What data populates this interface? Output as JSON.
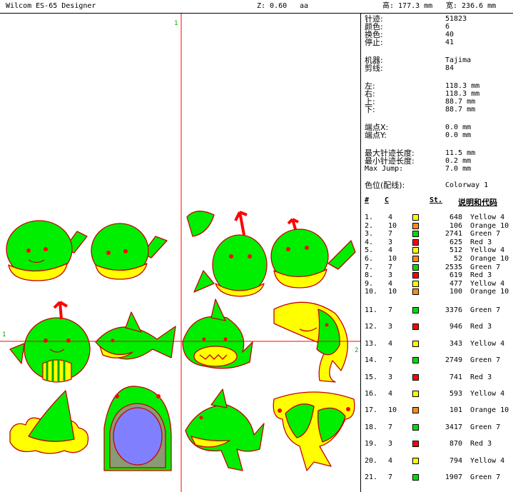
{
  "titlebar": {
    "app": "Wilcom ES-65 Designer",
    "zoom": "Z: 0.60",
    "aa": "aa",
    "height": "高: 177.3 mm",
    "width": "宽: 236.6 mm"
  },
  "canvas": {
    "guide_label_1": "1",
    "guide_label_2": "1",
    "guide_label_3": "2"
  },
  "stats": [
    {
      "label": "针迹:",
      "value": "51823"
    },
    {
      "label": "颜色:",
      "value": "6"
    },
    {
      "label": "换色:",
      "value": "40"
    },
    {
      "label": "停止:",
      "value": "41"
    },
    {
      "label": "机器:",
      "value": "Tajima"
    },
    {
      "label": "剪线:",
      "value": "84"
    },
    {
      "label": "左:",
      "value": "118.3 mm"
    },
    {
      "label": "右:",
      "value": "118.3 mm"
    },
    {
      "label": "上:",
      "value": "88.7 mm"
    },
    {
      "label": "下:",
      "value": "88.7 mm"
    },
    {
      "label": "端点X:",
      "value": "0.0 mm"
    },
    {
      "label": "端点Y:",
      "value": "0.0 mm"
    },
    {
      "label": "最大针迹长度:",
      "value": "11.5 mm"
    },
    {
      "label": "最小针迹长度:",
      "value": "0.2 mm"
    },
    {
      "label": "Max Jump:",
      "value": "7.0 mm"
    },
    {
      "label": "色位(配线):",
      "value": "Colorway 1"
    }
  ],
  "table": {
    "headers": {
      "idx": "#",
      "code": "C",
      "st": "St.",
      "desc": "说明和代码"
    },
    "rows": [
      {
        "idx": "1.",
        "code": "4",
        "color": "#ffff00",
        "st": "648",
        "name": "Yellow 4"
      },
      {
        "idx": "2.",
        "code": "10",
        "color": "#ff8c1a",
        "st": "106",
        "name": "Orange 10"
      },
      {
        "idx": "3.",
        "code": "7",
        "color": "#00dd00",
        "st": "2741",
        "name": "Green 7"
      },
      {
        "idx": "4.",
        "code": "3",
        "color": "#ff0000",
        "st": "625",
        "name": "Red 3"
      },
      {
        "idx": "5.",
        "code": "4",
        "color": "#ffff00",
        "st": "512",
        "name": "Yellow 4"
      },
      {
        "idx": "6.",
        "code": "10",
        "color": "#ff8c1a",
        "st": "52",
        "name": "Orange 10"
      },
      {
        "idx": "7.",
        "code": "7",
        "color": "#00dd00",
        "st": "2535",
        "name": "Green 7"
      },
      {
        "idx": "8.",
        "code": "3",
        "color": "#ff0000",
        "st": "619",
        "name": "Red 3"
      },
      {
        "idx": "9.",
        "code": "4",
        "color": "#ffff00",
        "st": "477",
        "name": "Yellow 4"
      },
      {
        "idx": "10.",
        "code": "10",
        "color": "#ff8c1a",
        "st": "100",
        "name": "Orange 10"
      },
      {
        "idx": "11.",
        "code": "7",
        "color": "#00dd00",
        "st": "3376",
        "name": "Green 7"
      },
      {
        "idx": "12.",
        "code": "3",
        "color": "#ff0000",
        "st": "946",
        "name": "Red 3"
      },
      {
        "idx": "13.",
        "code": "4",
        "color": "#ffff00",
        "st": "343",
        "name": "Yellow 4"
      },
      {
        "idx": "14.",
        "code": "7",
        "color": "#00dd00",
        "st": "2749",
        "name": "Green 7"
      },
      {
        "idx": "15.",
        "code": "3",
        "color": "#ff0000",
        "st": "741",
        "name": "Red 3"
      },
      {
        "idx": "16.",
        "code": "4",
        "color": "#ffff00",
        "st": "593",
        "name": "Yellow 4"
      },
      {
        "idx": "17.",
        "code": "10",
        "color": "#ff8c1a",
        "st": "101",
        "name": "Orange 10"
      },
      {
        "idx": "18.",
        "code": "7",
        "color": "#00dd00",
        "st": "3417",
        "name": "Green 7"
      },
      {
        "idx": "19.",
        "code": "3",
        "color": "#ff0000",
        "st": "870",
        "name": "Red 3"
      },
      {
        "idx": "20.",
        "code": "4",
        "color": "#ffff00",
        "st": "794",
        "name": "Yellow 4"
      },
      {
        "idx": "21.",
        "code": "7",
        "color": "#00dd00",
        "st": "1907",
        "name": "Green 7"
      }
    ]
  }
}
